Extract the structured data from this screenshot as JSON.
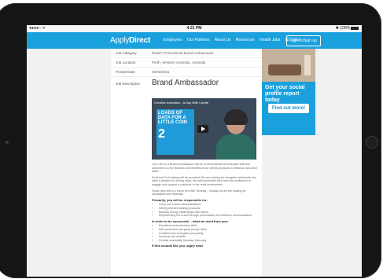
{
  "status_bar": {
    "left": "●●●●○ ᯤ",
    "time": "4:21 PM",
    "right": "✱ 100%"
  },
  "nav": {
    "logo_a": "Apply",
    "logo_b": "Direct",
    "links": [
      "Employers",
      "Our Partners",
      "About Us",
      "Resources",
      "Health Jobs",
      "NZ Jobs"
    ],
    "sign_in": "Sign In/Sign up"
  },
  "details": [
    {
      "label": "Job Category",
      "value": "Retail / Promotional Brand Ambassador"
    },
    {
      "label": "Job Location",
      "value": "Perth, Western Australia, Australia"
    },
    {
      "label": "Posted Date",
      "value": "05/03/2021"
    }
  ],
  "job": {
    "desc_label": "Job Description",
    "title": "Brand Ambassador",
    "video_title": "Creative Activation - A Day With Lizette",
    "poster_text": "LOADS OF DATA FOR A LITTLE COIN",
    "poster_number": "2",
    "intro1": "Your role as a Brand Ambassador will be to demonstrate and educate staff and customers on the features and benefits of our client's products to influence and drive sales.",
    "intro2": "Don't fret! Full training will be provided! We are looking for energetic individuals who have a passion for driving sales, are well-presented and have the confidence to engage and support a customer in the retail environment.",
    "intro3": "Hours vary with a 4 hours per shift, Monday - Sunday, so we are looking for candidates with flexibility!",
    "resp_heading": "Primarily, you will be responsible for:",
    "responsibilities": [
      "Carry out in store demonstrations",
      "Selling internet banking products",
      "Building strong relationships with stores",
      "Representing the brand through presentation and effective communication"
    ],
    "req_heading": "In order to be successful – what we need from you:",
    "requirements": [
      "Excellent communication skills",
      "Well presented and great people skills",
      "Confident and energetic personality",
      "Punctual and reliable",
      "Flexible availability Monday–Saturday"
    ],
    "closing": "If this sounds like you, apply now!"
  },
  "sidebar_ad": {
    "headline": "Get your social profile report today",
    "button": "Find out more!"
  }
}
